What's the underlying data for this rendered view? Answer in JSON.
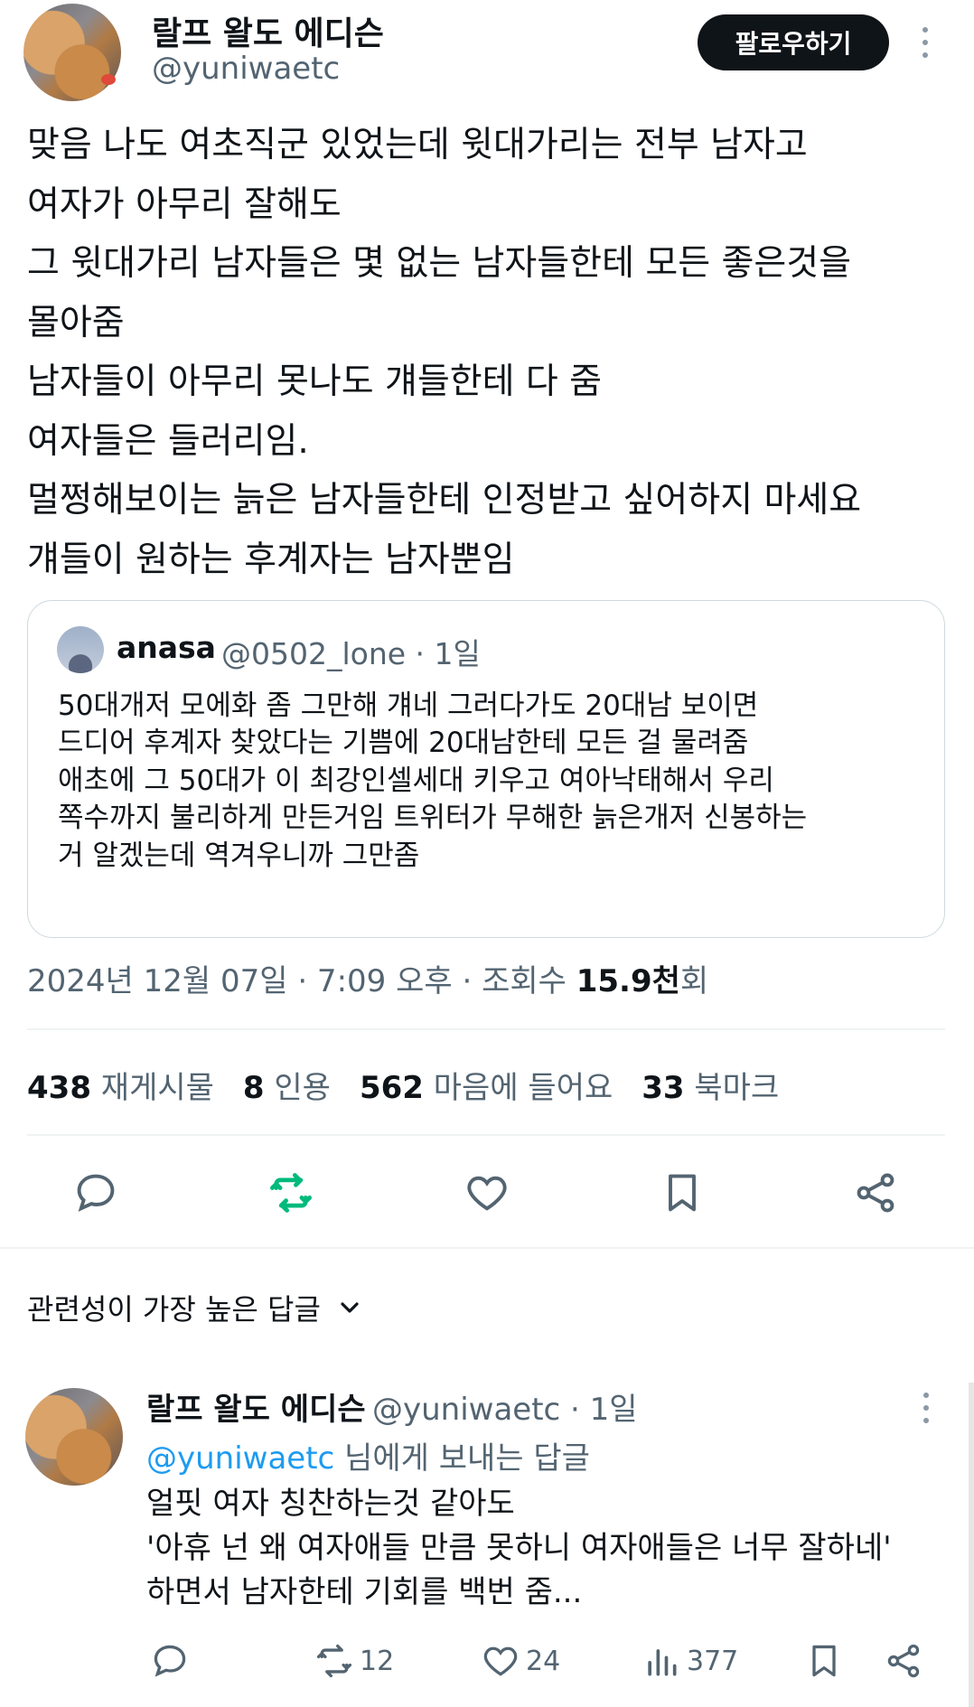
{
  "author": {
    "display_name": "랄프 왈도 에디슨",
    "handle": "@yuniwaetc",
    "follow_label": "팔로우하기"
  },
  "tweet": {
    "lines": [
      "맞음 나도 여초직군 있었는데 윗대가리는 전부 남자고",
      "여자가 아무리 잘해도",
      "그 윗대가리 남자들은 몇 없는 남자들한테 모든 좋은것을",
      "몰아줌",
      "남자들이 아무리 못나도 걔들한테 다 줌",
      "여자들은 들러리임.",
      "멀쩡해보이는 늙은 남자들한테 인정받고 싶어하지 마세요",
      "걔들이 원하는 후계자는 남자뿐임"
    ]
  },
  "quote": {
    "name": "anasa",
    "handle_time": "@0502_lone · 1일",
    "lines": [
      "50대개저 모에화 좀 그만해 걔네 그러다가도 20대남 보이면",
      "드디어 후계자 찾았다는 기쁨에 20대남한테 모든 걸 물려줌",
      "애초에 그 50대가 이 최강인셀세대 키우고 여아낙태해서 우리",
      "쪽수까지 불리하게 만든거임 트위터가 무해한 늙은개저 신봉하는",
      "거 알겠는데 역겨우니까 그만좀"
    ]
  },
  "meta": {
    "prefix": "2024년 12월 07일 · 7:09 오후 · 조회수 ",
    "views": "15.9천",
    "suffix": "회"
  },
  "stats": [
    {
      "num": "438",
      "label": "재게시물"
    },
    {
      "num": "8",
      "label": "인용"
    },
    {
      "num": "562",
      "label": "마음에 들어요"
    },
    {
      "num": "33",
      "label": "북마크"
    }
  ],
  "sort": {
    "label": "관련성이 가장 높은 답글"
  },
  "reply": {
    "display_name": "랄프 왈도 에디슨",
    "handle_time": "@yuniwaetc · 1일",
    "reply_mention": "@yuniwaetc",
    "reply_suffix": " 님에게 보내는 답글",
    "lines": [
      "얼핏 여자 칭찬하는것 같아도",
      "'아휴 넌 왜 여자애들 만큼 못하니 여자애들은 너무 잘하네'",
      "하면서 남자한테 기회를 백번 줌..."
    ],
    "retweets": "12",
    "likes": "24",
    "views": "377"
  },
  "colors": {
    "text": "#0f1419",
    "secondary": "#536471",
    "retweet_active": "#00ba7c",
    "link": "#1d9bf0",
    "border": "#cfd9de"
  }
}
